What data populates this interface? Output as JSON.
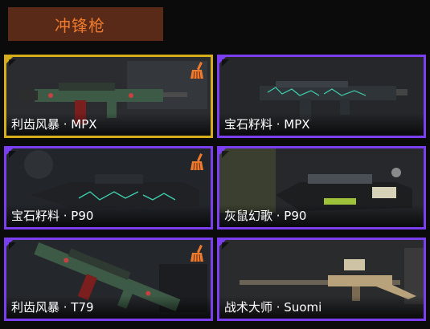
{
  "header": {
    "title": "冲锋枪"
  },
  "colors": {
    "accent_gold": "#d6ae1c",
    "accent_purple": "#7b3ff0",
    "title_orange": "#ee7a2e",
    "header_bg": "#5a2a18"
  },
  "cards": [
    {
      "name": "利齿风暴 · MPX",
      "frame": "gold",
      "has_broom_icon": true
    },
    {
      "name": "宝石籽料 · MPX",
      "frame": "purple",
      "has_broom_icon": false
    },
    {
      "name": "宝石籽料 · P90",
      "frame": "purple",
      "has_broom_icon": true
    },
    {
      "name": "灰鼠幻歌 · P90",
      "frame": "purple",
      "has_broom_icon": false
    },
    {
      "name": "利齿风暴 · T79",
      "frame": "purple",
      "has_broom_icon": true
    },
    {
      "name": "战术大师 · Suomi",
      "frame": "purple",
      "has_broom_icon": false
    }
  ]
}
